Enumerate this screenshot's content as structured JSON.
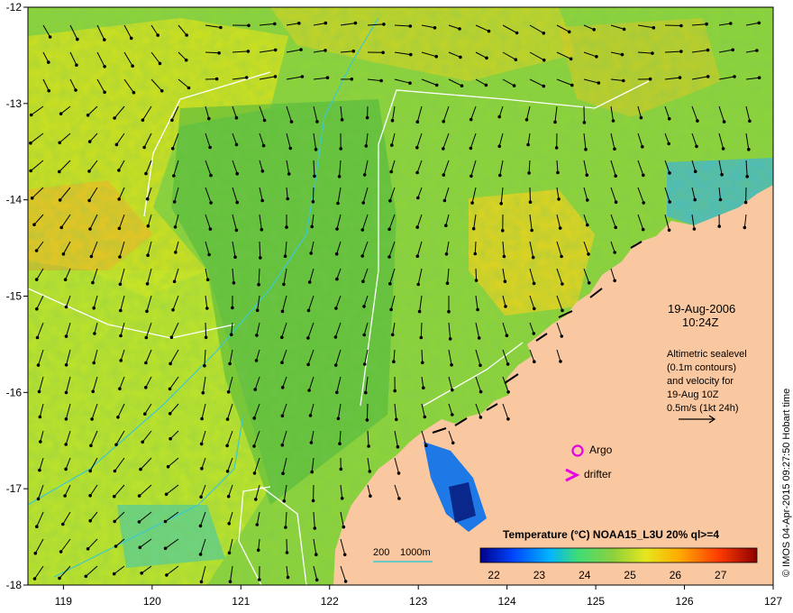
{
  "map": {
    "lon_ticks": [
      "119",
      "120",
      "121",
      "122",
      "123",
      "124",
      "125",
      "126",
      "127"
    ],
    "lat_ticks": [
      "-12",
      "-13",
      "-14",
      "-15",
      "-16",
      "-17",
      "-18"
    ],
    "lon_values": [
      119,
      120,
      121,
      122,
      123,
      124,
      125,
      126,
      127
    ],
    "lat_values": [
      -12,
      -13,
      -14,
      -15,
      -16,
      -17,
      -18
    ],
    "lon_range": [
      118.6,
      127
    ],
    "lat_range": [
      -12,
      -18
    ],
    "colors": {
      "land": "#fac8a0",
      "sea_base": "#8cd23c",
      "contour": "#ffffff",
      "bathymetry": "#3cc8d2",
      "arrow": "#000000",
      "argo": "#e600e6",
      "drifter": "#e600e6"
    }
  },
  "annotation": {
    "date": "19-Aug-2006",
    "time": "10:24Z",
    "alt_line1": "Altimetric sealevel",
    "alt_line2": "(0.1m contours)",
    "alt_line3": "and velocity for",
    "alt_line4": "19-Aug 10Z",
    "alt_line5": "0.5m/s (1kt 24h)"
  },
  "legend": {
    "argo": "Argo",
    "drifter": "drifter",
    "depth_200": "200",
    "depth_1000": "1000m"
  },
  "colorbar": {
    "title": "Temperature (°C) NOAA15_L3U 20% ql>=4",
    "ticks": [
      "22",
      "23",
      "24",
      "25",
      "26",
      "27"
    ]
  },
  "credit": "© IMOS 04-Apr-2015 09:27:50 Hobart time"
}
